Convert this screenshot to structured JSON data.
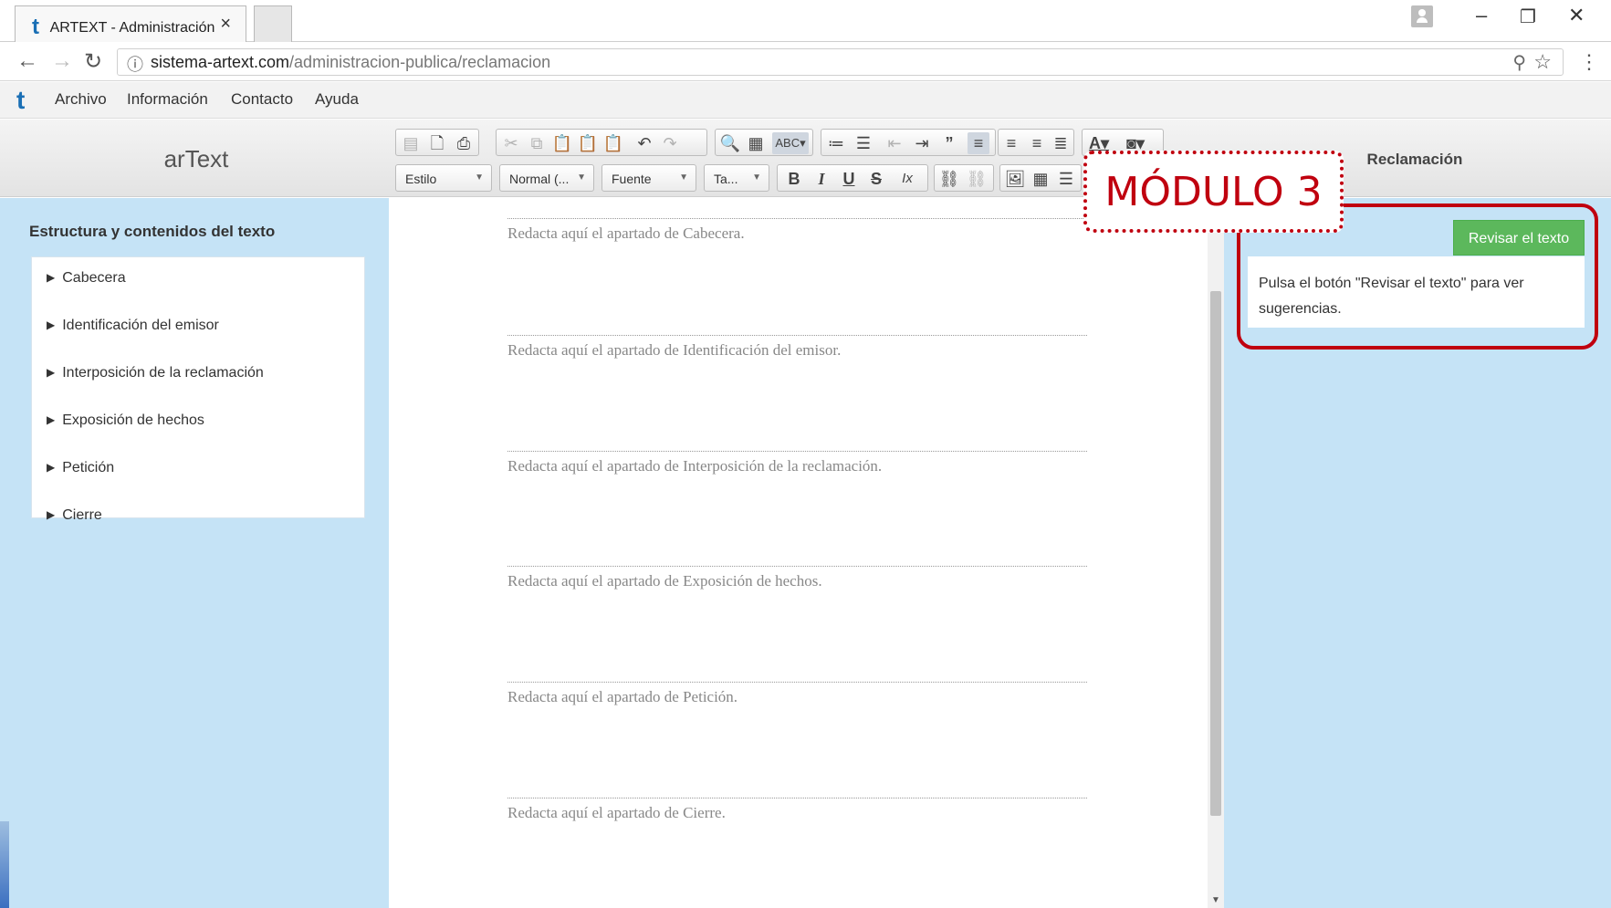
{
  "browser": {
    "tab_title": "ARTEXT - Administración",
    "tab_close": "×",
    "url_host": "sistema-artext.com",
    "url_path": "/administracion-publica/reclamacion"
  },
  "app_menu": {
    "logo": "t",
    "items": [
      "Archivo",
      "Información",
      "Contacto",
      "Ayuda"
    ]
  },
  "header": {
    "brand": "arText",
    "right_title": "Reclamación"
  },
  "toolbar": {
    "combos": {
      "style": "Estilo",
      "format": "Normal (...",
      "font": "Fuente",
      "size": "Ta..."
    },
    "formatting": {
      "bold": "B",
      "italic": "I",
      "underline": "U",
      "strike": "S",
      "clear": "Ix"
    }
  },
  "sidebar": {
    "title": "Estructura y contenidos del texto",
    "items": [
      {
        "label": "Cabecera"
      },
      {
        "label": "Identificación del emisor"
      },
      {
        "label": "Interposición de la reclamación"
      },
      {
        "label": "Exposición de hechos"
      },
      {
        "label": "Petición"
      },
      {
        "label": "Cierre"
      }
    ]
  },
  "editor": {
    "sections": [
      {
        "placeholder": "Redacta aquí el apartado de Cabecera."
      },
      {
        "placeholder": "Redacta aquí el apartado de Identificación del emisor."
      },
      {
        "placeholder": "Redacta aquí el apartado de Interposición de la reclamación."
      },
      {
        "placeholder": "Redacta aquí el apartado de Exposición de hechos."
      },
      {
        "placeholder": "Redacta aquí el apartado de Petición."
      },
      {
        "placeholder": "Redacta aquí el apartado de Cierre."
      }
    ]
  },
  "right_panel": {
    "review_button": "Revisar el texto",
    "suggestion_text": "Pulsa el botón \"Revisar el texto\" para ver sugerencias."
  },
  "annotation": {
    "module_label": "MÓDULO 3",
    "color": "#c0000f"
  },
  "colors": {
    "sidebar_bg": "#c5e3f6",
    "review_button_bg": "#5cb85c",
    "brand_blue": "#1a6fb5"
  }
}
